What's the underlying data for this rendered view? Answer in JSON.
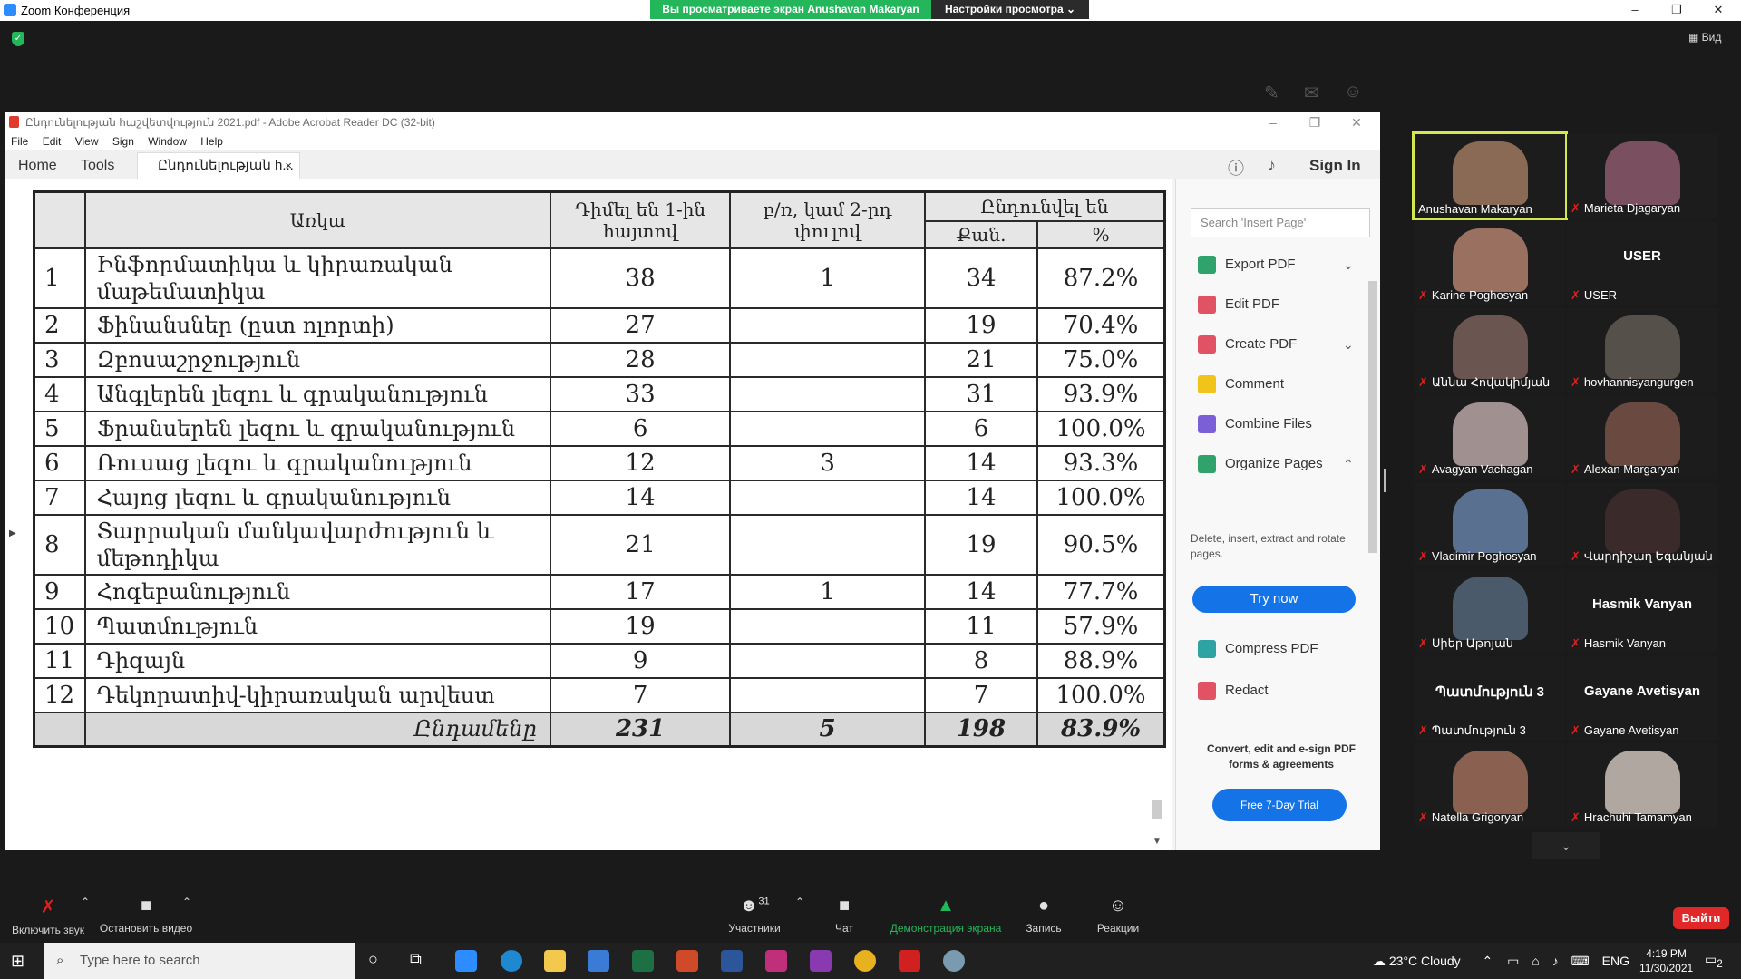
{
  "zoom": {
    "title": "Zoom Конференция",
    "share_banner": "Вы просматриваете экран Anushavan Makaryan",
    "view_settings": "Настройки просмотра ⌄",
    "view_button": "Вид",
    "win_min": "–",
    "win_max": "❐",
    "win_close": "✕"
  },
  "acrobat": {
    "title": "Ընդունելության հաշվետվություն 2021.pdf - Adobe Acrobat Reader DC (32-bit)",
    "menu": [
      "File",
      "Edit",
      "View",
      "Sign",
      "Window",
      "Help"
    ],
    "tab_home": "Home",
    "tab_tools": "Tools",
    "doc_tab": "Ընդունելության h...",
    "doc_tab_close": "×",
    "sign_in": "Sign In",
    "search_placeholder": "Search 'Insert Page'",
    "tools": [
      {
        "label": "Export PDF",
        "color": "#2fa36b",
        "chev": "⌄"
      },
      {
        "label": "Edit PDF",
        "color": "#e05264",
        "chev": ""
      },
      {
        "label": "Create PDF",
        "color": "#e05264",
        "chev": "⌄"
      },
      {
        "label": "Comment",
        "color": "#f0c419",
        "chev": ""
      },
      {
        "label": "Combine Files",
        "color": "#7b5fd6",
        "chev": ""
      },
      {
        "label": "Organize Pages",
        "color": "#2fa36b",
        "chev": "⌃"
      }
    ],
    "organize_desc": "Delete, insert, extract and rotate pages.",
    "try_now": "Try now",
    "tools2": [
      {
        "label": "Compress PDF",
        "color": "#2fa3a3"
      },
      {
        "label": "Redact",
        "color": "#e05264"
      }
    ],
    "promo": "Convert, edit and e-sign PDF forms & agreements",
    "trial": "Free 7-Day Trial"
  },
  "table": {
    "h_subject": "Առկա",
    "h_first": "Դիմել են 1-ին հայտով",
    "h_second": "բ/ռ, կամ 2-րդ փուլով",
    "h_admitted": "Ընդունվել են",
    "h_qty": "Քան.",
    "h_pct": "%",
    "rows": [
      {
        "n": "1",
        "name": "Ինֆորմատիկա և կիրառական մաթեմատիկա",
        "a": "38",
        "b": "1",
        "c": "34",
        "p": "87.2%"
      },
      {
        "n": "2",
        "name": "Ֆինանսներ (ըստ ոլորտի)",
        "a": "27",
        "b": "",
        "c": "19",
        "p": "70.4%"
      },
      {
        "n": "3",
        "name": "Զբոսաշրջություն",
        "a": "28",
        "b": "",
        "c": "21",
        "p": "75.0%"
      },
      {
        "n": "4",
        "name": "Անգլերեն լեզու և գրականություն",
        "a": "33",
        "b": "",
        "c": "31",
        "p": "93.9%"
      },
      {
        "n": "5",
        "name": "Ֆրանսերեն լեզու և գրականություն",
        "a": "6",
        "b": "",
        "c": "6",
        "p": "100.0%"
      },
      {
        "n": "6",
        "name": "Ռուսաց լեզու և գրականություն",
        "a": "12",
        "b": "3",
        "c": "14",
        "p": "93.3%"
      },
      {
        "n": "7",
        "name": "Հայոց լեզու և գրականություն",
        "a": "14",
        "b": "",
        "c": "14",
        "p": "100.0%"
      },
      {
        "n": "8",
        "name": "Տարրական մանկավարժություն և մեթոդիկա",
        "a": "21",
        "b": "",
        "c": "19",
        "p": "90.5%"
      },
      {
        "n": "9",
        "name": "Հոգեբանություն",
        "a": "17",
        "b": "1",
        "c": "14",
        "p": "77.7%"
      },
      {
        "n": "10",
        "name": "Պատմություն",
        "a": "19",
        "b": "",
        "c": "11",
        "p": "57.9%"
      },
      {
        "n": "11",
        "name": "Դիզայն",
        "a": "9",
        "b": "",
        "c": "8",
        "p": "88.9%"
      },
      {
        "n": "12",
        "name": "Դեկորատիվ-կիրառական արվեստ",
        "a": "7",
        "b": "",
        "c": "7",
        "p": "100.0%"
      }
    ],
    "total": {
      "label": "Ընդամենը",
      "a": "231",
      "b": "5",
      "c": "198",
      "p": "83.9%"
    }
  },
  "participants": [
    {
      "name": "Anushavan Makaryan",
      "muted": false,
      "active": true,
      "color": "#8a6a55",
      "big": ""
    },
    {
      "name": "Marieta Djagaryan",
      "muted": true,
      "active": false,
      "color": "#7a5060",
      "big": ""
    },
    {
      "name": "Karine Poghosyan",
      "muted": true,
      "active": false,
      "color": "#9a7060",
      "big": ""
    },
    {
      "name": "USER",
      "muted": true,
      "active": false,
      "color": "",
      "big": "USER"
    },
    {
      "name": "Աննա Հովակիմյան",
      "muted": true,
      "active": false,
      "color": "#6a5550",
      "big": ""
    },
    {
      "name": "hovhannisyangurgen",
      "muted": true,
      "active": false,
      "color": "#55504a",
      "big": ""
    },
    {
      "name": "Avagyan Vachagan",
      "muted": true,
      "active": false,
      "color": "#a09090",
      "big": ""
    },
    {
      "name": "Alexan Margaryan",
      "muted": true,
      "active": false,
      "color": "#6a4a40",
      "big": ""
    },
    {
      "name": "Vladimir Poghosyan",
      "muted": true,
      "active": false,
      "color": "#5a7090",
      "big": ""
    },
    {
      "name": "Վարդիշաղ Եգանյան",
      "muted": true,
      "active": false,
      "color": "#3a2a2a",
      "big": ""
    },
    {
      "name": "Սիեր Աթոյան",
      "muted": true,
      "active": false,
      "color": "#4a5a6a",
      "big": ""
    },
    {
      "name": "Hasmik Vanyan",
      "muted": true,
      "active": false,
      "color": "",
      "big": "Hasmik Vanyan"
    },
    {
      "name": "Պատմություն 3",
      "muted": true,
      "active": false,
      "color": "",
      "big": "Պատմություն 3"
    },
    {
      "name": "Gayane Avetisyan",
      "muted": true,
      "active": false,
      "color": "",
      "big": "Gayane Avetisyan"
    },
    {
      "name": "Natella Grigoryan",
      "muted": true,
      "active": false,
      "color": "#8a6050",
      "big": ""
    },
    {
      "name": "Hrachuhi Tamamyan",
      "muted": true,
      "active": false,
      "color": "#b0a8a0",
      "big": ""
    }
  ],
  "toolbar": {
    "unmute": "Включить звук",
    "stop_video": "Остановить видео",
    "participants": "Участники",
    "participants_count": "31",
    "chat": "Чат",
    "share": "Демонстрация экрана",
    "record": "Запись",
    "reactions": "Реакции",
    "leave": "Выйти"
  },
  "taskbar": {
    "search_placeholder": "Type here to search",
    "weather": "23°C  Cloudy",
    "lang": "ENG",
    "time": "4:19 PM",
    "date": "11/30/2021",
    "notif": "2"
  }
}
